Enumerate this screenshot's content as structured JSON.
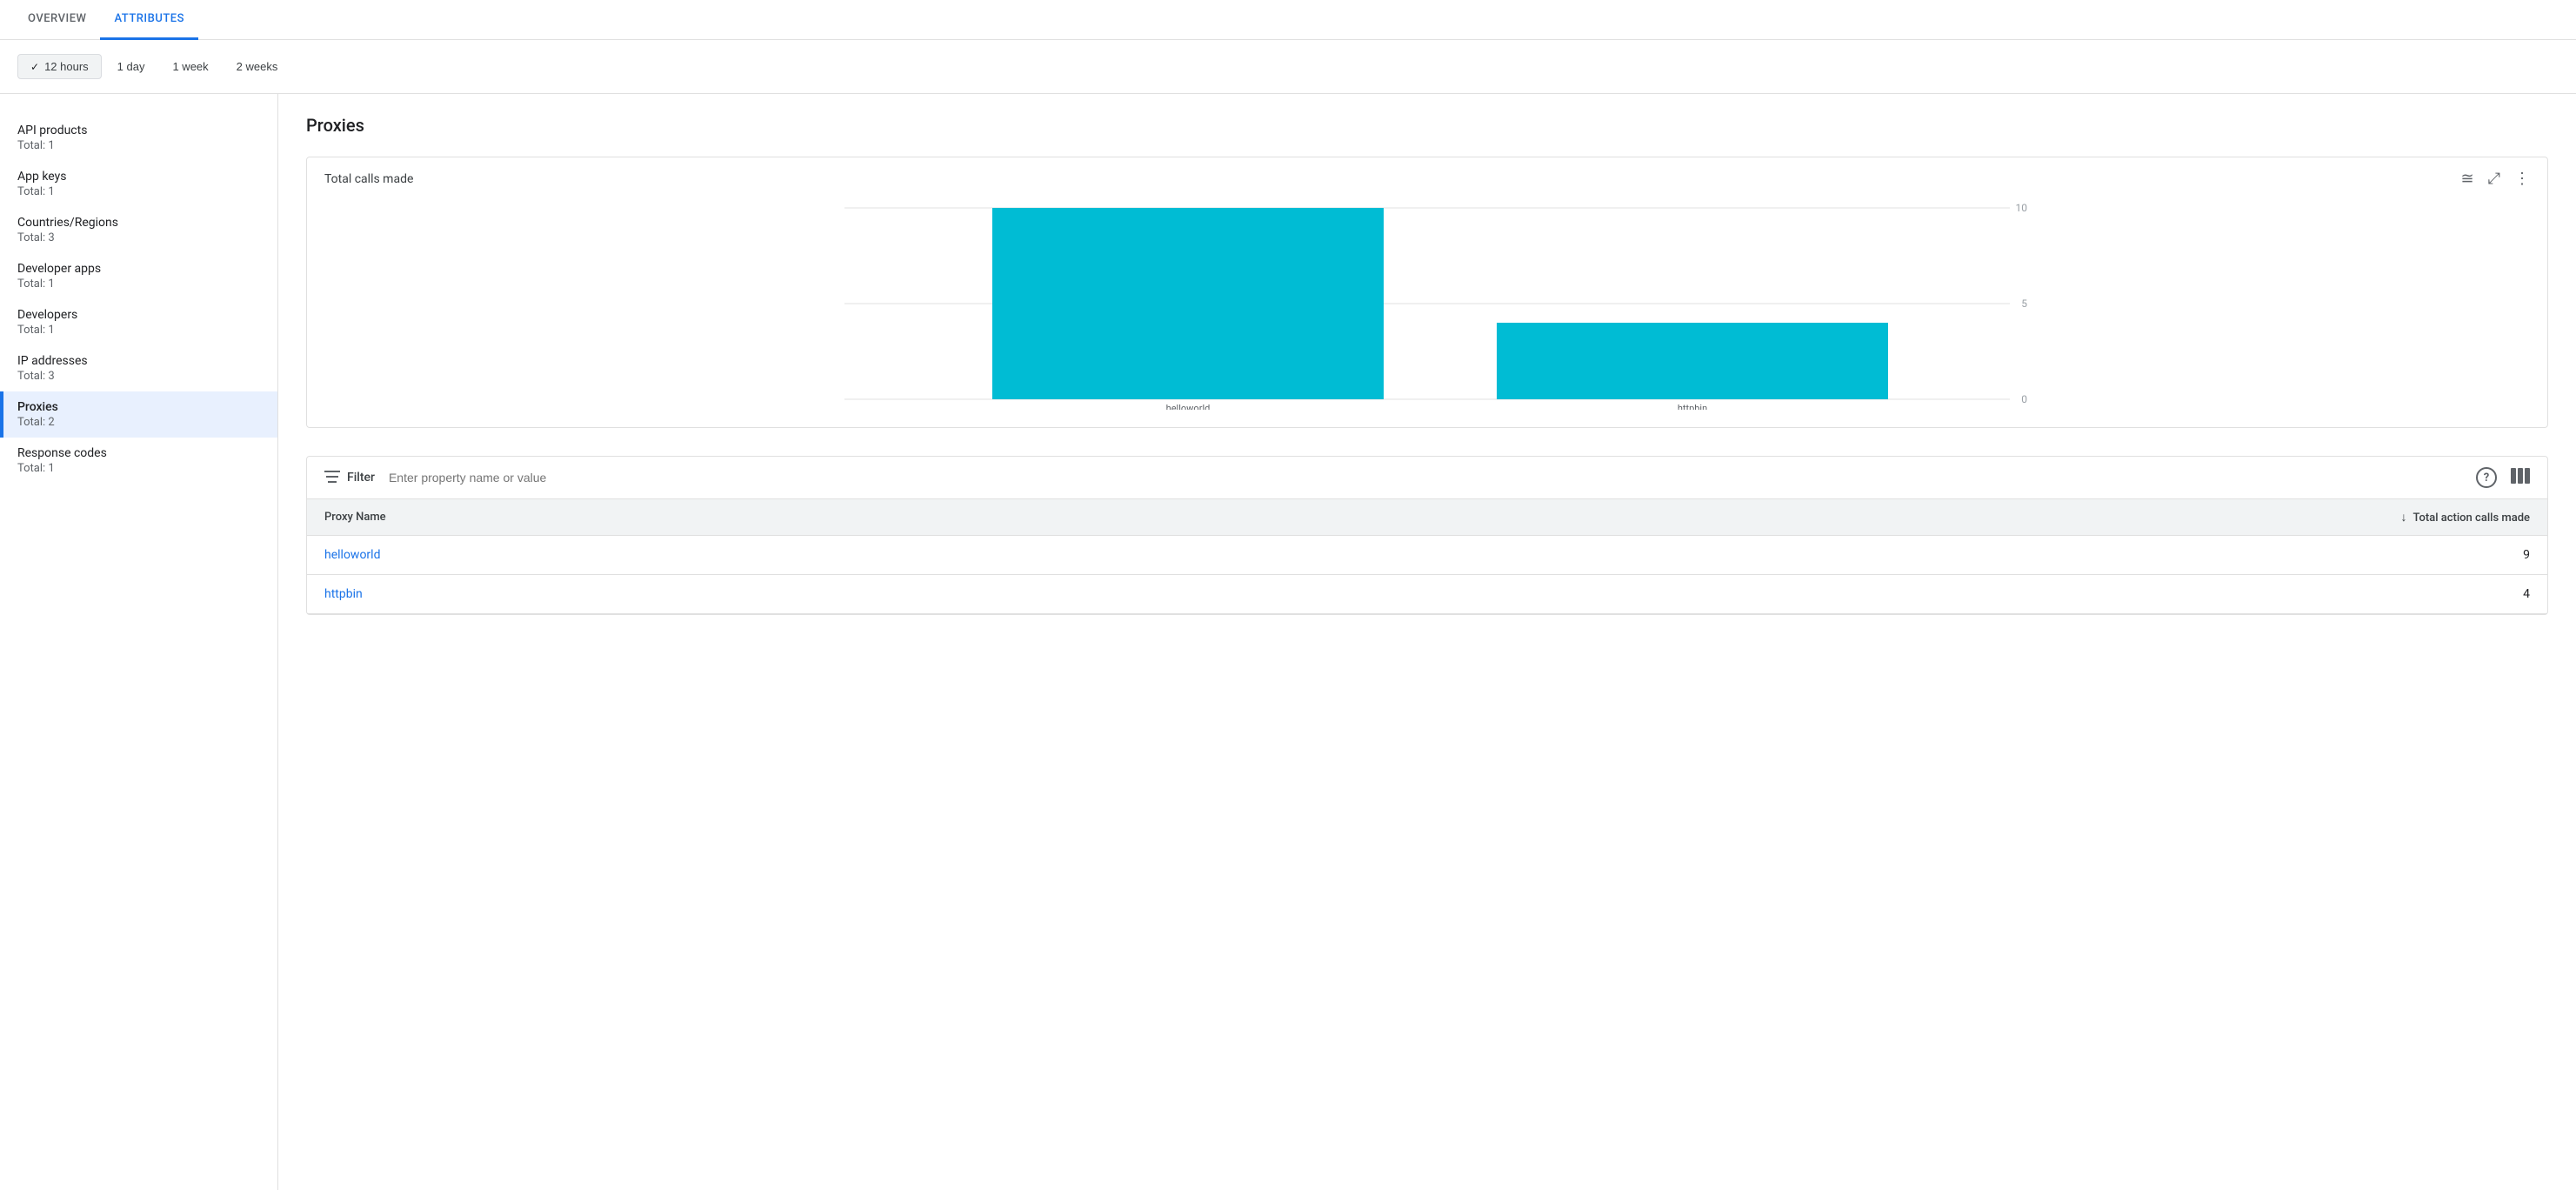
{
  "tabs": [
    {
      "id": "overview",
      "label": "OVERVIEW",
      "active": false
    },
    {
      "id": "attributes",
      "label": "ATTRIBUTES",
      "active": true
    }
  ],
  "timeFilter": {
    "options": [
      {
        "id": "12hours",
        "label": "12 hours",
        "selected": true
      },
      {
        "id": "1day",
        "label": "1 day",
        "selected": false
      },
      {
        "id": "1week",
        "label": "1 week",
        "selected": false
      },
      {
        "id": "2weeks",
        "label": "2 weeks",
        "selected": false
      }
    ]
  },
  "sidebar": {
    "items": [
      {
        "id": "api-products",
        "name": "API products",
        "total": "Total: 1",
        "active": false
      },
      {
        "id": "app-keys",
        "name": "App keys",
        "total": "Total: 1",
        "active": false
      },
      {
        "id": "countries-regions",
        "name": "Countries/Regions",
        "total": "Total: 3",
        "active": false
      },
      {
        "id": "developer-apps",
        "name": "Developer apps",
        "total": "Total: 1",
        "active": false
      },
      {
        "id": "developers",
        "name": "Developers",
        "total": "Total: 1",
        "active": false
      },
      {
        "id": "ip-addresses",
        "name": "IP addresses",
        "total": "Total: 3",
        "active": false
      },
      {
        "id": "proxies",
        "name": "Proxies",
        "total": "Total: 2",
        "active": true
      },
      {
        "id": "response-codes",
        "name": "Response codes",
        "total": "Total: 1",
        "active": false
      }
    ]
  },
  "content": {
    "title": "Proxies",
    "chart": {
      "title": "Total calls made",
      "yAxisMax": 10,
      "yAxisMid": 5,
      "yAxisMin": 0,
      "bars": [
        {
          "label": "helloworld",
          "value": 10,
          "color": "#00BCD4"
        },
        {
          "label": "httpbin",
          "value": 4,
          "color": "#00BCD4"
        }
      ]
    },
    "filter": {
      "label": "Filter",
      "placeholder": "Enter property name or value"
    },
    "table": {
      "columns": [
        {
          "id": "proxy-name",
          "label": "Proxy Name",
          "sortable": false
        },
        {
          "id": "total-calls",
          "label": "Total action calls made",
          "sortable": true,
          "sortDir": "desc"
        }
      ],
      "rows": [
        {
          "name": "helloworld",
          "calls": 9
        },
        {
          "name": "httpbin",
          "calls": 4
        }
      ]
    }
  },
  "icons": {
    "checkmark": "✓",
    "filter": "☰",
    "help": "?",
    "columns": "|||",
    "sort_down": "↓",
    "hamburger_chart": "≅",
    "fullscreen": "⤢",
    "more_vert": "⋮"
  }
}
